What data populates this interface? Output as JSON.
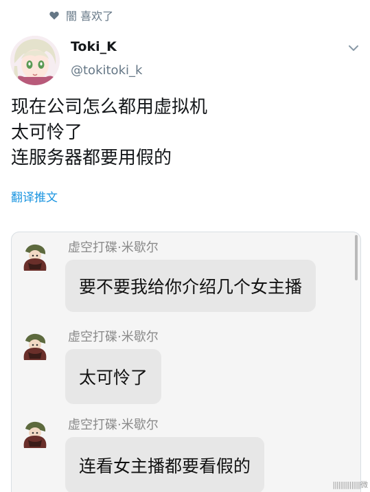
{
  "liked_by": {
    "icon": "heart-icon",
    "text": "闇 喜欢了"
  },
  "tweet": {
    "avatar_icon": "anime-girl-avatar",
    "display_name": "Toki_K",
    "handle": "@tokitoki_k",
    "more_icon": "chevron-down-icon",
    "lines": [
      "现在公司怎么都用虚拟机",
      "太可怜了",
      "连服务器都要用假的"
    ],
    "translate_label": "翻译推文"
  },
  "chat": {
    "messages": [
      {
        "sender": "虚空打碟·米歇尔",
        "text": "要不要我给你介绍几个女主播"
      },
      {
        "sender": "虚空打碟·米歇尔",
        "text": "太可怜了"
      },
      {
        "sender": "虚空打碟·米歇尔",
        "text": "连看女主播都要看假的"
      }
    ],
    "watermark": "|||||||||||||||微"
  },
  "colors": {
    "link": "#1b95e0",
    "secondary_text": "#657786",
    "bubble": "#e7e7e7",
    "chat_background": "#f5f5f5"
  }
}
